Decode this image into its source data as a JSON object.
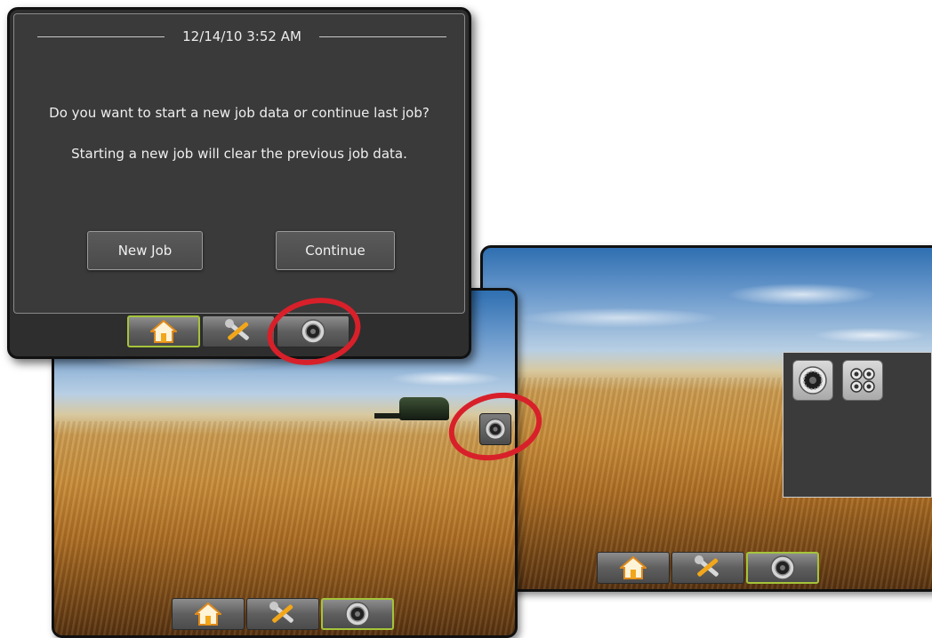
{
  "dialog": {
    "datetime": "12/14/10 3:52 AM",
    "message_primary": "Do you want to start a new job data or continue last job?",
    "message_secondary": "Starting a new job will clear the previous job data.",
    "new_job_label": "New Job",
    "continue_label": "Continue"
  },
  "navbar": {
    "items": [
      {
        "icon": "home-icon"
      },
      {
        "icon": "tools-icon"
      },
      {
        "icon": "camera-icon"
      }
    ]
  },
  "camera_panel": {
    "items": [
      {
        "icon": "single-camera-icon"
      },
      {
        "icon": "quad-camera-icon"
      }
    ]
  },
  "colors": {
    "highlight_ring": "#d8202a",
    "active_nav_border": "#a4c43a",
    "dialog_background": "#3a3a3a"
  }
}
